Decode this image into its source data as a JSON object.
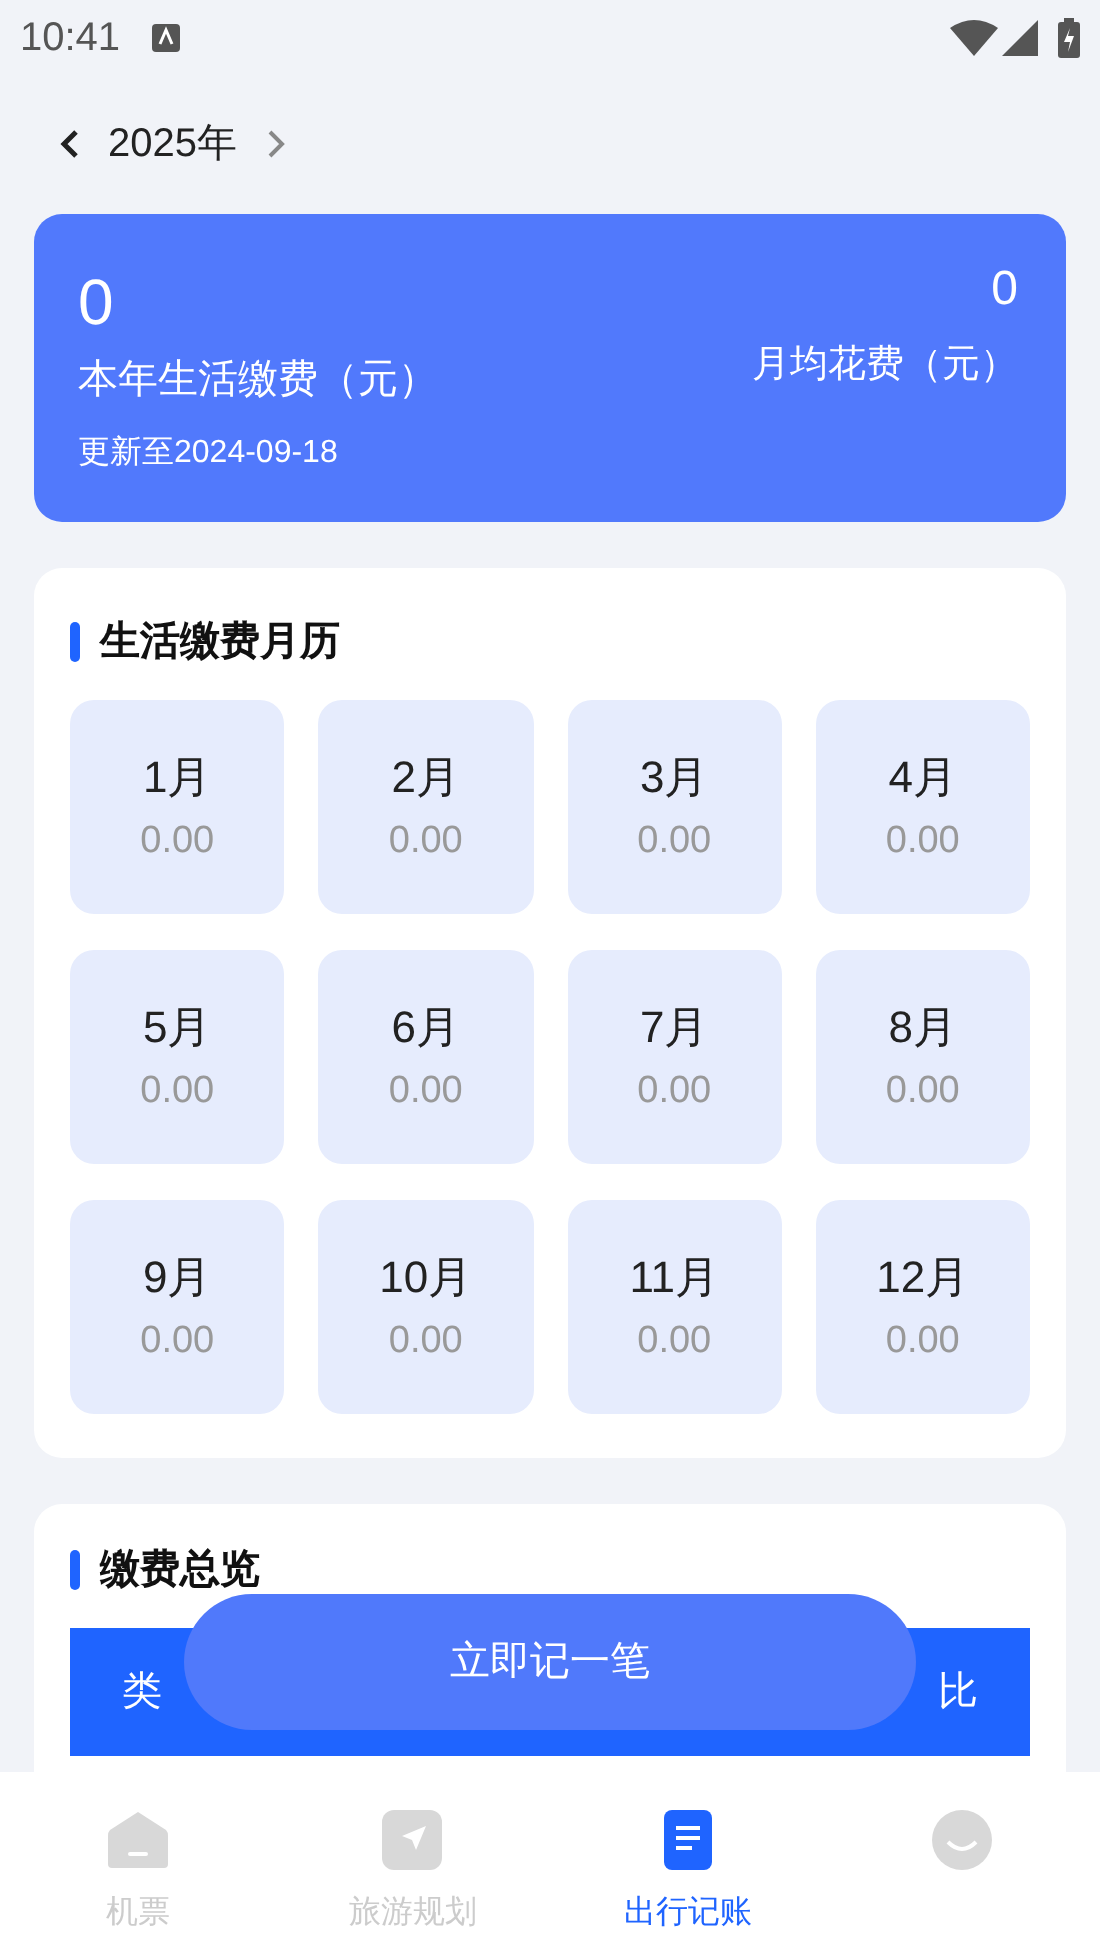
{
  "status_bar": {
    "time": "10:41"
  },
  "year_nav": {
    "year": "2025年"
  },
  "summary": {
    "total": "0",
    "total_label": "本年生活缴费（元）",
    "updated": "更新至2024-09-18",
    "monthly_avg": "0",
    "monthly_avg_label": "月均花费（元）"
  },
  "calendar": {
    "title": "生活缴费月历",
    "months": [
      {
        "month": "1月",
        "amount": "0.00"
      },
      {
        "month": "2月",
        "amount": "0.00"
      },
      {
        "month": "3月",
        "amount": "0.00"
      },
      {
        "month": "4月",
        "amount": "0.00"
      },
      {
        "month": "5月",
        "amount": "0.00"
      },
      {
        "month": "6月",
        "amount": "0.00"
      },
      {
        "month": "7月",
        "amount": "0.00"
      },
      {
        "month": "8月",
        "amount": "0.00"
      },
      {
        "month": "9月",
        "amount": "0.00"
      },
      {
        "month": "10月",
        "amount": "0.00"
      },
      {
        "month": "11月",
        "amount": "0.00"
      },
      {
        "month": "12月",
        "amount": "0.00"
      }
    ]
  },
  "overview": {
    "title": "缴费总览",
    "columns": [
      "类",
      "比"
    ]
  },
  "record_button": "立即记一笔",
  "tabs": [
    {
      "kind": "home",
      "label": "机票",
      "selected": false
    },
    {
      "kind": "navigate",
      "label": "旅游规划",
      "selected": false
    },
    {
      "kind": "document",
      "label": "出行记账",
      "selected": true
    },
    {
      "kind": "profile",
      "selected": false
    }
  ]
}
